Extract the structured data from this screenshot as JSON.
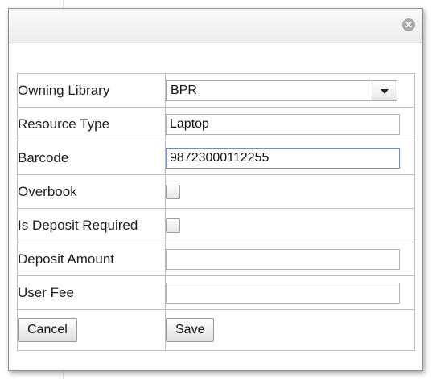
{
  "dialog": {
    "close_icon": "close-icon"
  },
  "form": {
    "owning_library": {
      "label": "Owning Library",
      "value": "BPR"
    },
    "resource_type": {
      "label": "Resource Type",
      "value": "Laptop"
    },
    "barcode": {
      "label": "Barcode",
      "value": "98723000112255"
    },
    "overbook": {
      "label": "Overbook",
      "checked": false
    },
    "is_deposit_required": {
      "label": "Is Deposit Required",
      "checked": false
    },
    "deposit_amount": {
      "label": "Deposit Amount",
      "value": ""
    },
    "user_fee": {
      "label": "User Fee",
      "value": ""
    }
  },
  "actions": {
    "cancel_label": "Cancel",
    "save_label": "Save"
  },
  "colors": {
    "border": "#bdbdbd",
    "focus_border": "#6f8fb5",
    "titlebar": "#ececec"
  }
}
